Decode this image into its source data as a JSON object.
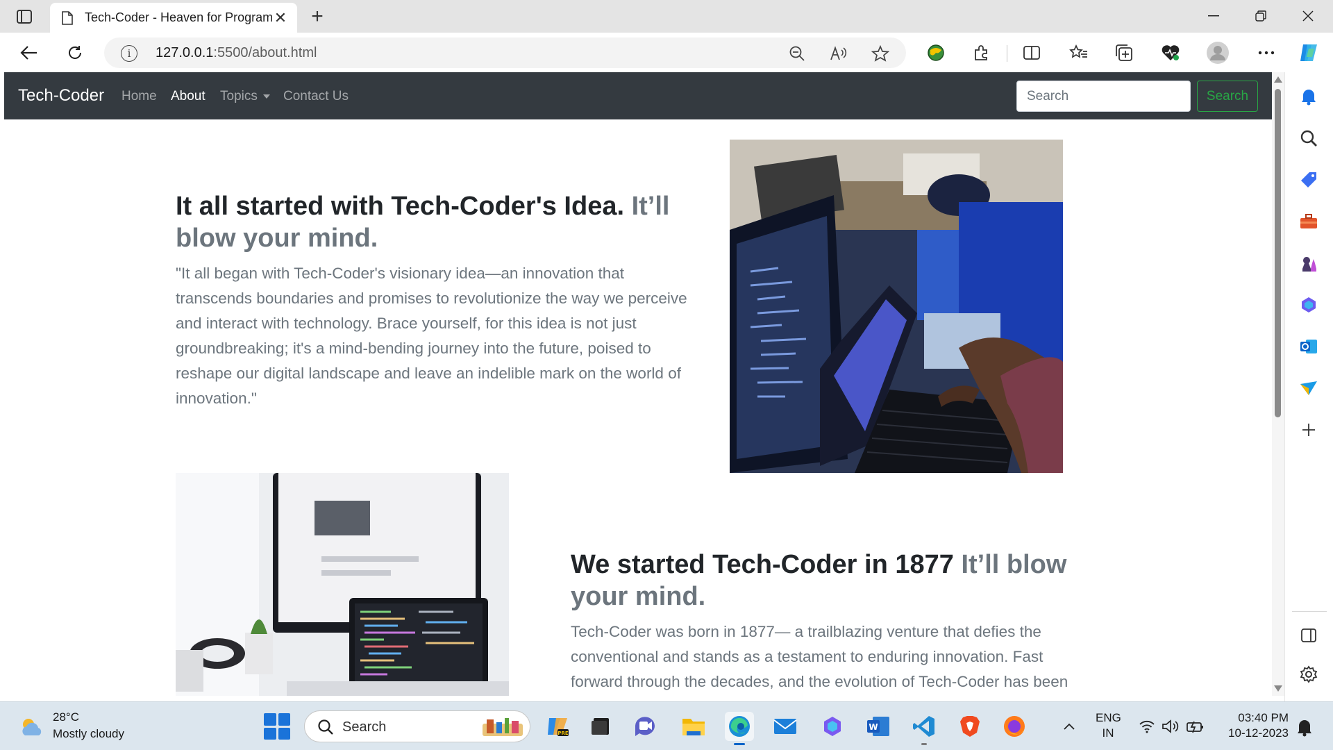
{
  "browser": {
    "tab_title": "Tech-Coder - Heaven for Programmers",
    "url_host": "127.0.0.1",
    "url_path": ":5500/about.html",
    "accent_color": "#1a73e8"
  },
  "navbar": {
    "brand": "Tech-Coder",
    "links": [
      "Home",
      "About",
      "Topics",
      "Contact Us"
    ],
    "active_link": "About",
    "search_placeholder": "Search",
    "search_button": "Search",
    "background_color": "#343a40",
    "search_button_color": "#28a745"
  },
  "featurette_1": {
    "heading": "It all started with Tech-Coder's Idea.",
    "heading_muted": "It’ll blow your mind.",
    "text": "\"It all began with Tech-Coder's visionary idea—an innovation that transcends boundaries and promises to revolutionize the way we perceive and interact with technology. Brace yourself, for this idea is not just groundbreaking; it's a mind-bending journey into the future, poised to reshape our digital landscape and leave an indelible mark on the world of innovation.\""
  },
  "featurette_2": {
    "heading": "We started Tech-Coder in 1877",
    "heading_muted": "It’ll blow your mind.",
    "text": "Tech-Coder was born in 1877— a trailblazing venture that defies the conventional and stands as a testament to enduring innovation. Fast forward through the decades, and the evolution of Tech-Coder has been"
  },
  "taskbar": {
    "weather_temp": "28°C",
    "weather_desc": "Mostly cloudy",
    "search_label": "Search",
    "lang_line1": "ENG",
    "lang_line2": "IN",
    "time": "03:40 PM",
    "date": "10-12-2023"
  }
}
